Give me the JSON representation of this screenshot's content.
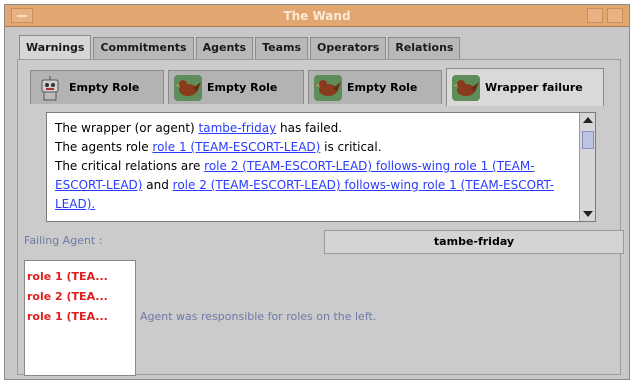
{
  "window": {
    "title": "The Wand"
  },
  "tabs": [
    "Warnings",
    "Commitments",
    "Agents",
    "Teams",
    "Operators",
    "Relations"
  ],
  "subtabs": [
    "Empty Role",
    "Empty Role",
    "Empty Role",
    "Wrapper failure"
  ],
  "message": {
    "line1_pre": "The wrapper (or agent) ",
    "line1_link": "tambe-friday",
    "line1_post": " has failed.",
    "line2_pre": "The agents role ",
    "line2_link": "role 1 (TEAM-ESCORT-LEAD)",
    "line2_post": " is critical.",
    "line3_pre": "The critical relations are ",
    "link_a": " role 2 (TEAM-ESCORT-LEAD) follows-wing role 1 (TEAM-ESCORT-LEAD)",
    "mid": " and ",
    "link_b": "role 2 (TEAM-ESCORT-LEAD) follows-wing role 1 (TEAM-ESCORT-LEAD)."
  },
  "failing_agent_label": "Failing Agent :",
  "failing_agent_value": "tambe-friday",
  "roles": [
    "role 1 (TEA...",
    "role 2 (TEA...",
    "role 1 (TEA..."
  ],
  "responsible_text": "Agent was responsible for roles on the left."
}
